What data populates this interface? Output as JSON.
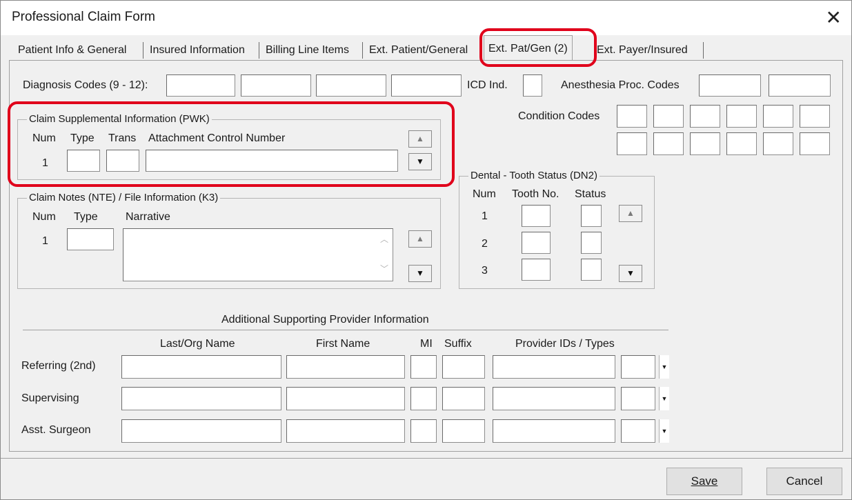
{
  "window": {
    "title": "Professional Claim Form",
    "close_glyph": "✕"
  },
  "tabs": [
    {
      "label": "Patient Info & General"
    },
    {
      "label": "Insured Information"
    },
    {
      "label": "Billing Line Items"
    },
    {
      "label": "Ext. Patient/General"
    },
    {
      "label": "Ext. Pat/Gen (2)",
      "active": true
    },
    {
      "label": "Ext. Payer/Insured"
    }
  ],
  "diagnosis": {
    "label": "Diagnosis Codes (9 - 12):",
    "values": [
      "",
      "",
      "",
      ""
    ]
  },
  "icd": {
    "label": "ICD Ind.",
    "value": ""
  },
  "anesthesia": {
    "label": "Anesthesia Proc. Codes",
    "values": [
      "",
      ""
    ]
  },
  "condition": {
    "label": "Condition Codes",
    "values": [
      "",
      "",
      "",
      "",
      "",
      "",
      "",
      "",
      "",
      "",
      "",
      ""
    ]
  },
  "pwk": {
    "title": "Claim Supplemental Information (PWK)",
    "headers": {
      "num": "Num",
      "type": "Type",
      "trans": "Trans",
      "acn": "Attachment Control Number"
    },
    "row": {
      "num": "1",
      "type": "",
      "trans": "",
      "acn": ""
    }
  },
  "notes": {
    "title": "Claim Notes (NTE) / File Information (K3)",
    "headers": {
      "num": "Num",
      "type": "Type",
      "narrative": "Narrative"
    },
    "row": {
      "num": "1",
      "type": "",
      "narrative": ""
    }
  },
  "dental": {
    "title": "Dental - Tooth Status (DN2)",
    "headers": {
      "num": "Num",
      "tooth": "Tooth No.",
      "status": "Status"
    },
    "rows": [
      {
        "num": "1"
      },
      {
        "num": "2"
      },
      {
        "num": "3"
      }
    ]
  },
  "providers": {
    "title": "Additional Supporting Provider Information",
    "headers": {
      "last": "Last/Org Name",
      "first": "First Name",
      "mi": "MI",
      "suffix": "Suffix",
      "ids": "Provider IDs / Types"
    },
    "rows": [
      {
        "label": "Referring (2nd)"
      },
      {
        "label": "Supervising"
      },
      {
        "label": "Asst. Surgeon"
      }
    ]
  },
  "buttons": {
    "save": "Save",
    "cancel": "Cancel"
  },
  "highlight_color": "#e0001b"
}
